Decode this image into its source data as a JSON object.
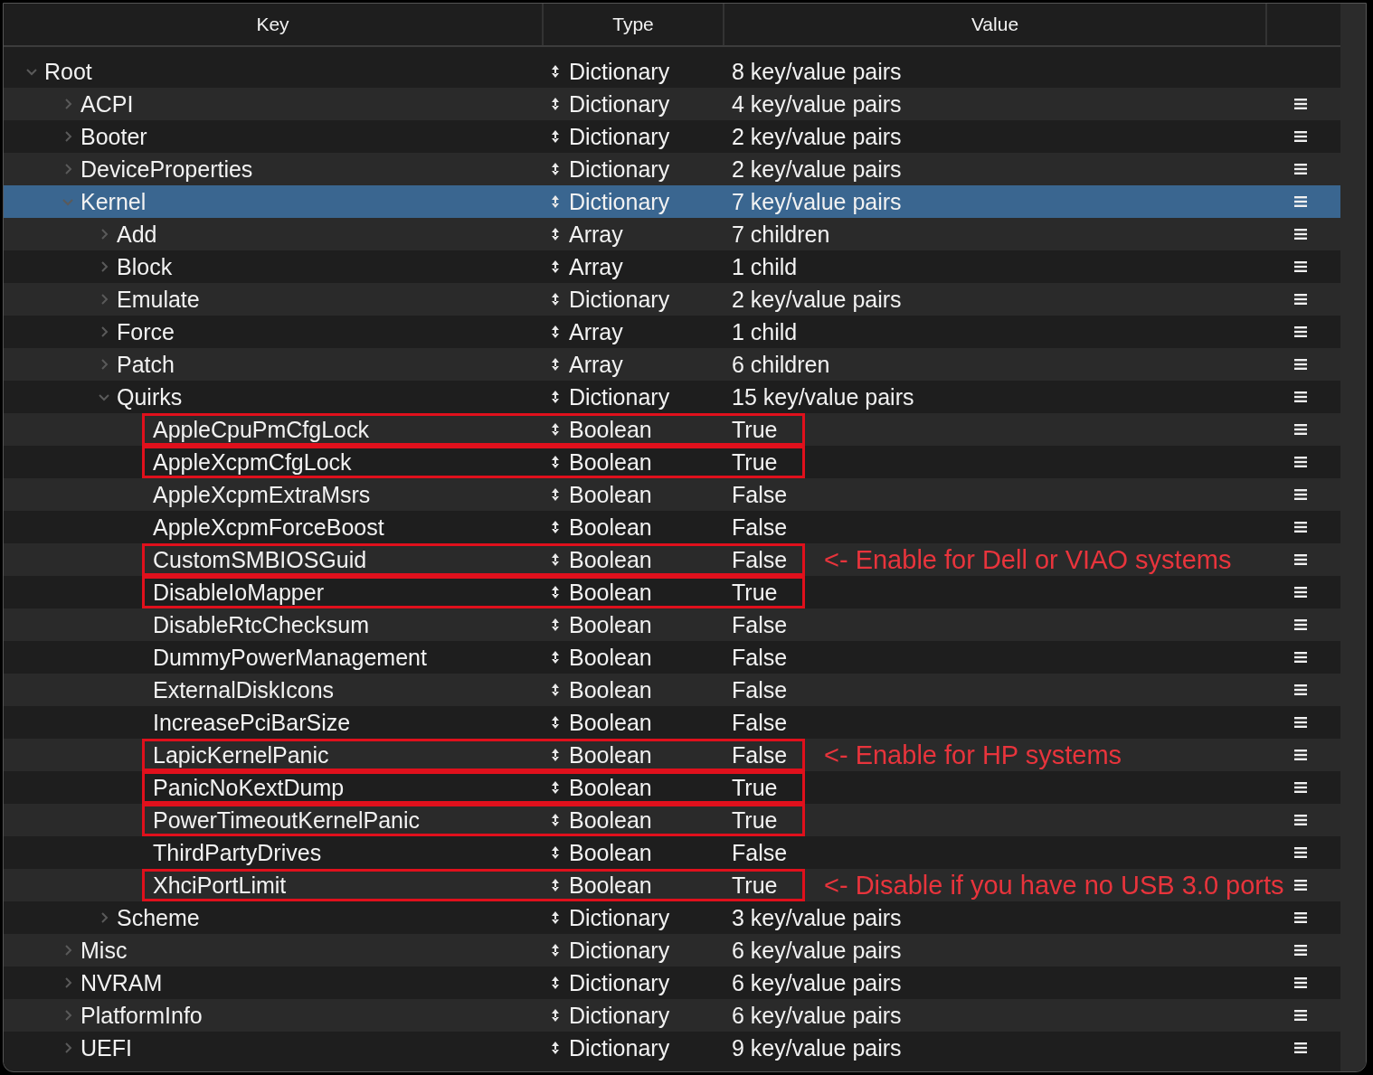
{
  "columns": [
    "Key",
    "Type",
    "Value"
  ],
  "tree": {
    "key": "Root",
    "type": "Dictionary",
    "value": "8 key/value pairs",
    "expanded": true,
    "selected": false,
    "children": [
      {
        "key": "ACPI",
        "type": "Dictionary",
        "value": "4 key/value pairs",
        "expanded": false,
        "selected": false
      },
      {
        "key": "Booter",
        "type": "Dictionary",
        "value": "2 key/value pairs",
        "expanded": false,
        "selected": false
      },
      {
        "key": "DeviceProperties",
        "type": "Dictionary",
        "value": "2 key/value pairs",
        "expanded": false,
        "selected": false
      },
      {
        "key": "Kernel",
        "type": "Dictionary",
        "value": "7 key/value pairs",
        "expanded": true,
        "selected": true,
        "children": [
          {
            "key": "Add",
            "type": "Array",
            "value": "7 children",
            "expanded": false,
            "selected": false
          },
          {
            "key": "Block",
            "type": "Array",
            "value": "1 child",
            "expanded": false,
            "selected": false
          },
          {
            "key": "Emulate",
            "type": "Dictionary",
            "value": "2 key/value pairs",
            "expanded": false,
            "selected": false
          },
          {
            "key": "Force",
            "type": "Array",
            "value": "1 child",
            "expanded": false,
            "selected": false
          },
          {
            "key": "Patch",
            "type": "Array",
            "value": "6 children",
            "expanded": false,
            "selected": false
          },
          {
            "key": "Quirks",
            "type": "Dictionary",
            "value": "15 key/value pairs",
            "expanded": true,
            "selected": false,
            "children": [
              {
                "key": "AppleCpuPmCfgLock",
                "type": "Boolean",
                "value": "True",
                "selected": false,
                "highlighted": true
              },
              {
                "key": "AppleXcpmCfgLock",
                "type": "Boolean",
                "value": "True",
                "selected": false,
                "highlighted": true
              },
              {
                "key": "AppleXcpmExtraMsrs",
                "type": "Boolean",
                "value": "False",
                "selected": false,
                "highlighted": false
              },
              {
                "key": "AppleXcpmForceBoost",
                "type": "Boolean",
                "value": "False",
                "selected": false,
                "highlighted": false
              },
              {
                "key": "CustomSMBIOSGuid",
                "type": "Boolean",
                "value": "False",
                "selected": false,
                "highlighted": true,
                "note": "<- Enable for Dell or VIAO systems"
              },
              {
                "key": "DisableIoMapper",
                "type": "Boolean",
                "value": "True",
                "selected": false,
                "highlighted": true
              },
              {
                "key": "DisableRtcChecksum",
                "type": "Boolean",
                "value": "False",
                "selected": false,
                "highlighted": false
              },
              {
                "key": "DummyPowerManagement",
                "type": "Boolean",
                "value": "False",
                "selected": false,
                "highlighted": false
              },
              {
                "key": "ExternalDiskIcons",
                "type": "Boolean",
                "value": "False",
                "selected": false,
                "highlighted": false
              },
              {
                "key": "IncreasePciBarSize",
                "type": "Boolean",
                "value": "False",
                "selected": false,
                "highlighted": false
              },
              {
                "key": "LapicKernelPanic",
                "type": "Boolean",
                "value": "False",
                "selected": false,
                "highlighted": true,
                "note": "<- Enable for HP systems"
              },
              {
                "key": "PanicNoKextDump",
                "type": "Boolean",
                "value": "True",
                "selected": false,
                "highlighted": true
              },
              {
                "key": "PowerTimeoutKernelPanic",
                "type": "Boolean",
                "value": "True",
                "selected": false,
                "highlighted": true
              },
              {
                "key": "ThirdPartyDrives",
                "type": "Boolean",
                "value": "False",
                "selected": false,
                "highlighted": false
              },
              {
                "key": "XhciPortLimit",
                "type": "Boolean",
                "value": "True",
                "selected": false,
                "highlighted": true,
                "note": "<- Disable if you have no USB 3.0 ports"
              }
            ]
          },
          {
            "key": "Scheme",
            "type": "Dictionary",
            "value": "3 key/value pairs",
            "expanded": false,
            "selected": false
          }
        ]
      },
      {
        "key": "Misc",
        "type": "Dictionary",
        "value": "6 key/value pairs",
        "expanded": false,
        "selected": false
      },
      {
        "key": "NVRAM",
        "type": "Dictionary",
        "value": "6 key/value pairs",
        "expanded": false,
        "selected": false
      },
      {
        "key": "PlatformInfo",
        "type": "Dictionary",
        "value": "6 key/value pairs",
        "expanded": false,
        "selected": false
      },
      {
        "key": "UEFI",
        "type": "Dictionary",
        "value": "9 key/value pairs",
        "expanded": false,
        "selected": false
      }
    ]
  }
}
